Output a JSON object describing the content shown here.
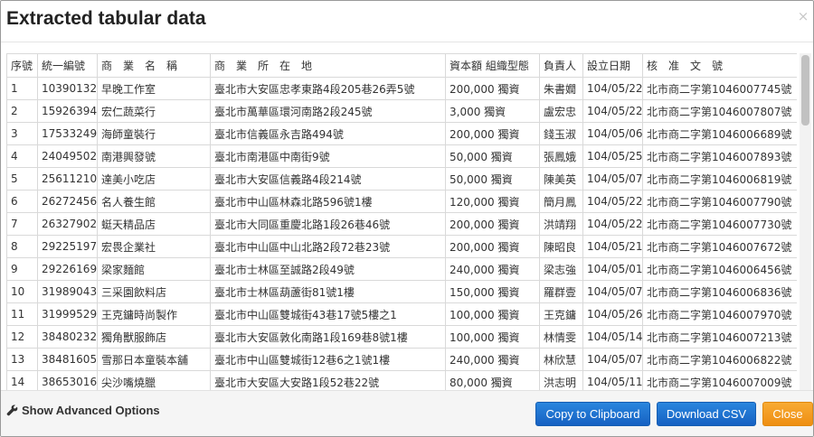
{
  "dialog": {
    "title": "Extracted tabular data",
    "close_glyph": "×"
  },
  "table": {
    "headers": [
      "序號",
      "統一編號",
      "商　業　名　稱",
      "商　業　所　在　地",
      "資本額 組織型態",
      "負責人",
      "設立日期",
      "核　准　文　號"
    ],
    "rows": [
      [
        "1",
        "10390132",
        "早晚工作室",
        "臺北市大安區忠孝東路4段205巷26弄5號",
        "200,000 獨資",
        "朱書嫺",
        "104/05/22",
        "北市商二字第1046007745號"
      ],
      [
        "2",
        "15926394",
        "宏仁蔬菜行",
        "臺北市萬華區環河南路2段245號",
        "3,000 獨資",
        "盧宏忠",
        "104/05/22",
        "北市商二字第1046007807號"
      ],
      [
        "3",
        "17533249",
        "海師童裝行",
        "臺北市信義區永吉路494號",
        "200,000 獨資",
        "錢玉淑",
        "104/05/06",
        "北市商二字第1046006689號"
      ],
      [
        "4",
        "24049502",
        "南港興發號",
        "臺北市南港區中南街9號",
        "50,000 獨資",
        "張鳳娥",
        "104/05/25",
        "北市商二字第1046007893號"
      ],
      [
        "5",
        "25611210",
        "達美小吃店",
        "臺北市大安區信義路4段214號",
        "50,000 獨資",
        "陳美英",
        "104/05/07",
        "北市商二字第1046006819號"
      ],
      [
        "6",
        "26272456",
        "名人養生館",
        "臺北市中山區林森北路596號1樓",
        "120,000 獨資",
        "簡月鳳",
        "104/05/22",
        "北市商二字第1046007790號"
      ],
      [
        "7",
        "26327902",
        "蜓天精品店",
        "臺北市大同區重慶北路1段26巷46號",
        "200,000 獨資",
        "洪靖翔",
        "104/05/22",
        "北市商二字第1046007730號"
      ],
      [
        "8",
        "29225197",
        "宏畏企業社",
        "臺北市中山區中山北路2段72巷23號",
        "200,000 獨資",
        "陳昭良",
        "104/05/21",
        "北市商二字第1046007672號"
      ],
      [
        "9",
        "29226169",
        "梁家麵館",
        "臺北市士林區至誠路2段49號",
        "240,000 獨資",
        "梁志強",
        "104/05/01",
        "北市商二字第1046006456號"
      ],
      [
        "10",
        "31989043",
        "三采園飲料店",
        "臺北市士林區葫蘆街81號1樓",
        "150,000 獨資",
        "羅群壹",
        "104/05/07",
        "北市商二字第1046006836號"
      ],
      [
        "11",
        "31999529",
        "王克鏞時尚製作",
        "臺北市中山區雙城街43巷17號5樓之1",
        "100,000 獨資",
        "王克鏞",
        "104/05/26",
        "北市商二字第1046007970號"
      ],
      [
        "12",
        "38480232",
        "獨角獸服飾店",
        "臺北市大安區敦化南路1段169巷8號1樓",
        "100,000 獨資",
        "林情雯",
        "104/05/14",
        "北市商二字第1046007213號"
      ],
      [
        "13",
        "38481605",
        "雪那日本童裝本舖",
        "臺北市中山區雙城街12巷6之1號1樓",
        "240,000 獨資",
        "林欣慧",
        "104/05/07",
        "北市商二字第1046006822號"
      ],
      [
        "14",
        "38653016",
        "尖沙嘴燒臘",
        "臺北市大安區大安路1段52巷22號",
        "80,000 獨資",
        "洪志明",
        "104/05/11",
        "北市商二字第1046007009號"
      ]
    ]
  },
  "footer": {
    "advanced_label": "Show Advanced Options",
    "advanced_icon": "wrench-icon",
    "copy_label": "Copy to Clipboard",
    "download_label": "Download CSV",
    "close_label": "Close",
    "colors": {
      "primary": "#1a6fd0",
      "warning": "#f39a1a"
    }
  }
}
